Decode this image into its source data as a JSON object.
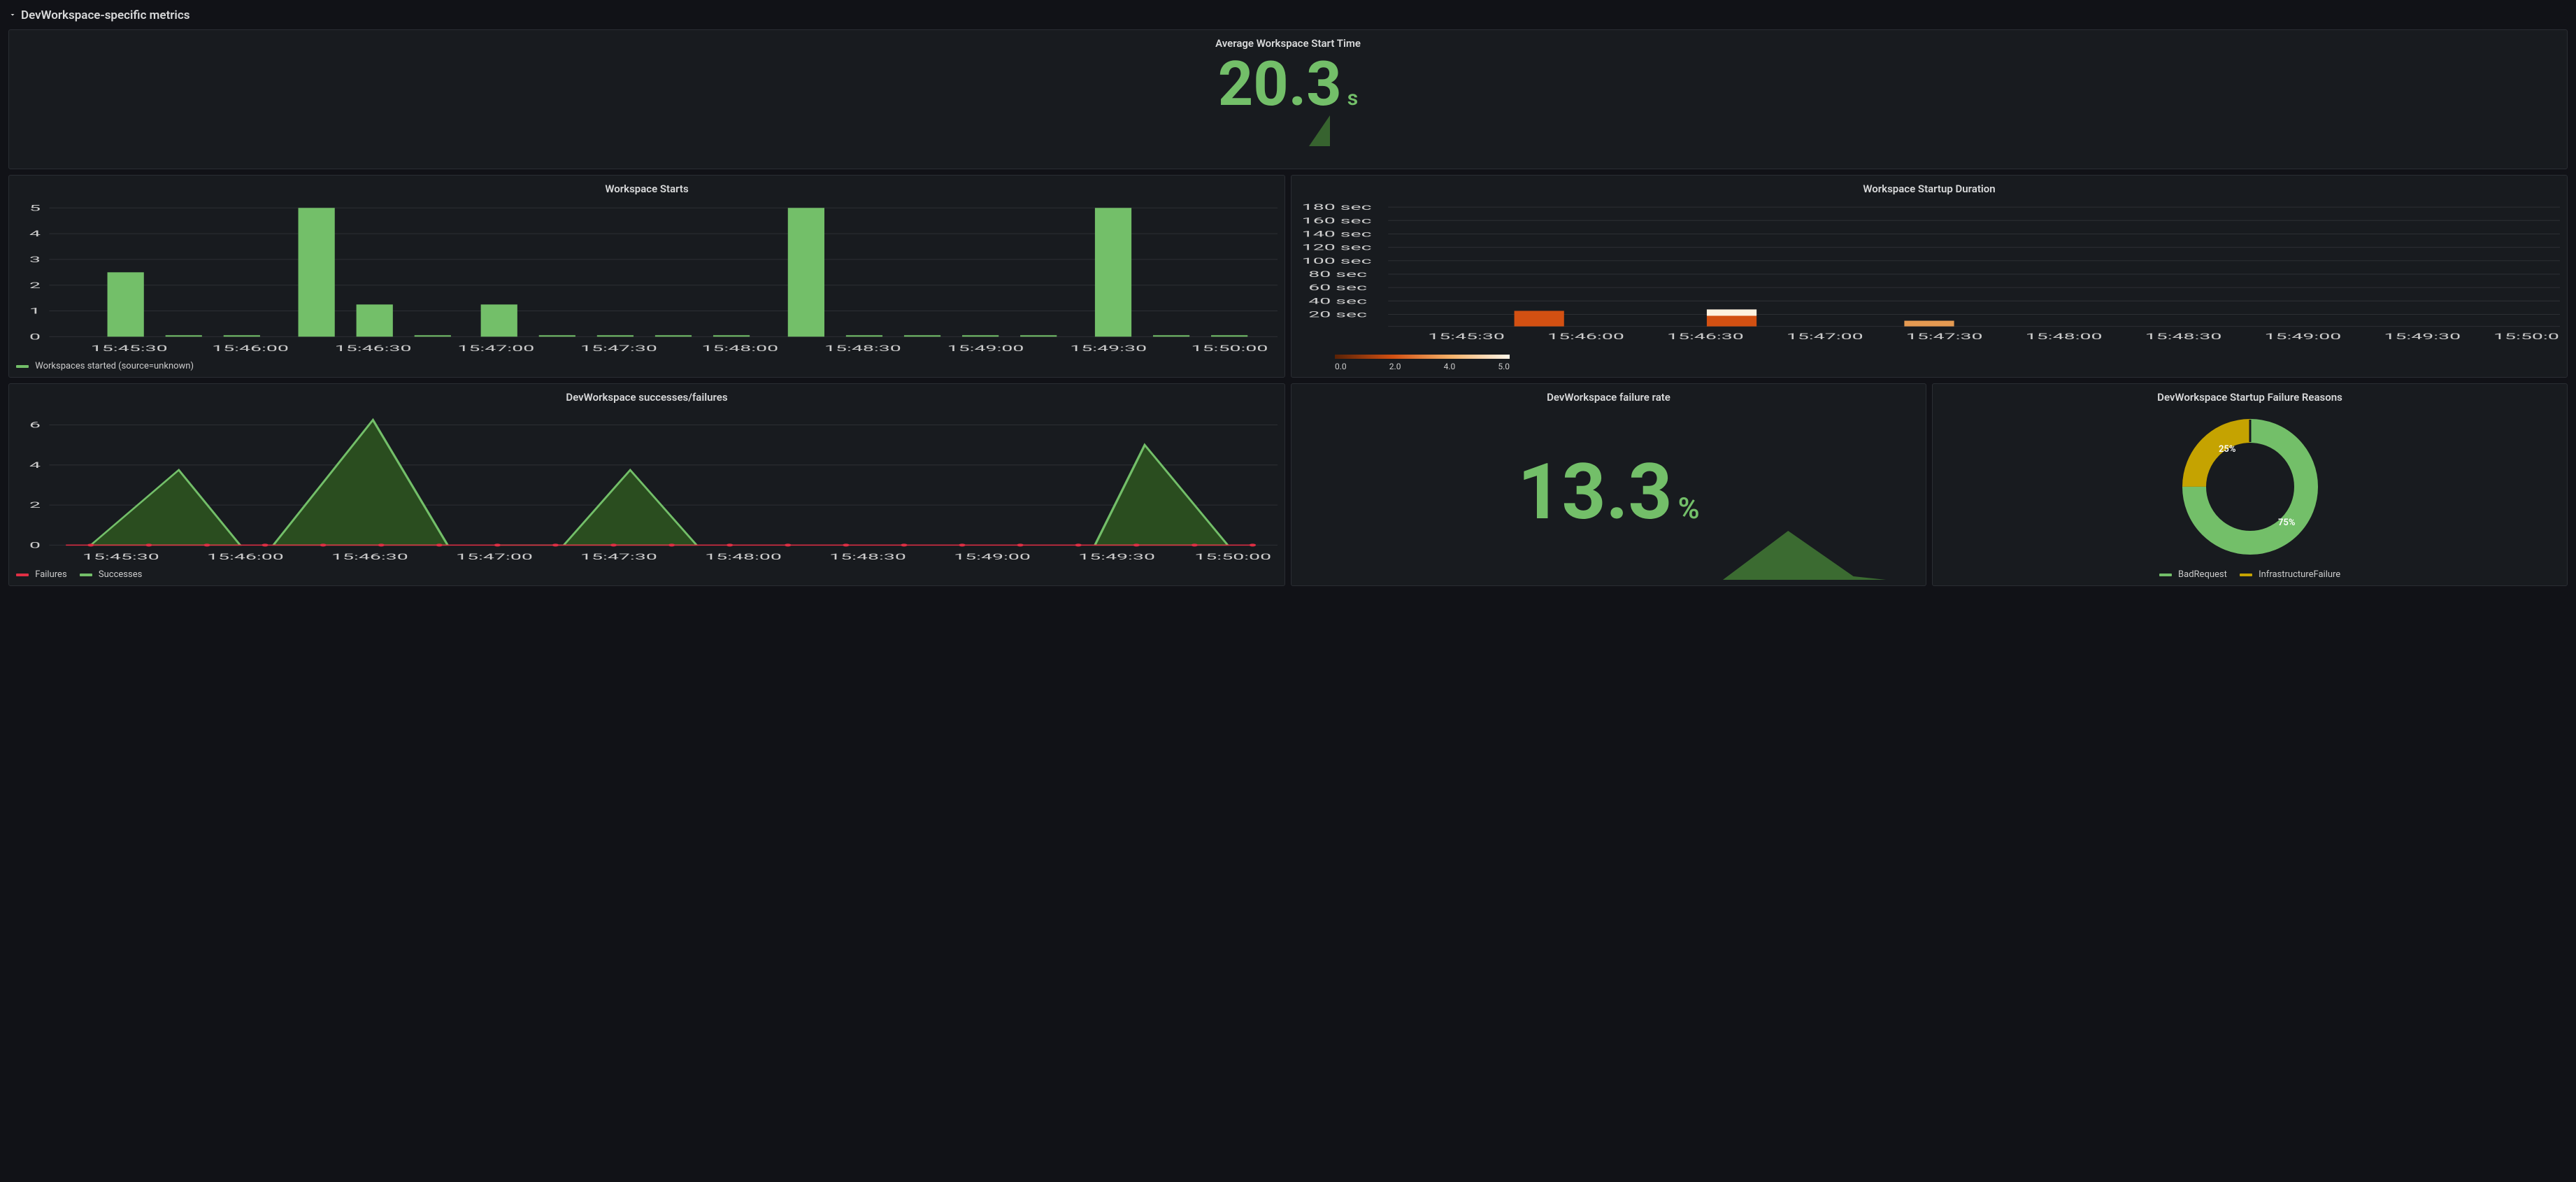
{
  "section_title": "DevWorkspace-specific metrics",
  "colors": {
    "green": "#73bf69",
    "dark_green_fill": "#2a4d1f",
    "red": "#e02f44",
    "yellow": "#c5a301"
  },
  "panels": {
    "avg": {
      "title": "Average Workspace Start Time",
      "value": "20.3",
      "unit": "s"
    },
    "starts": {
      "title": "Workspace Starts",
      "legend": "Workspaces started (source=unknown)"
    },
    "dur": {
      "title": "Workspace Startup Duration"
    },
    "sf": {
      "title": "DevWorkspace successes/failures",
      "legend_failures": "Failures",
      "legend_successes": "Successes"
    },
    "rate": {
      "title": "DevWorkspace failure rate",
      "value": "13.3",
      "unit": "%"
    },
    "reasons": {
      "title": "DevWorkspace Startup Failure Reasons",
      "legend_bad": "BadRequest",
      "legend_infra": "InfrastructureFailure"
    }
  },
  "chart_data": [
    {
      "id": "avg_start_time",
      "type": "stat",
      "title": "Average Workspace Start Time",
      "value": 20.3,
      "unit": "s",
      "sparkline": [
        0.0,
        0.0,
        0.0,
        20.3
      ]
    },
    {
      "id": "workspace_starts",
      "type": "bar",
      "title": "Workspace Starts",
      "xlabel": "",
      "ylabel": "",
      "ylim": [
        0,
        5
      ],
      "yticks": [
        0,
        1,
        2,
        3,
        4,
        5
      ],
      "categories": [
        "15:45:30",
        "15:46:00",
        "15:46:30",
        "15:47:00",
        "15:47:30",
        "15:48:00",
        "15:48:30",
        "15:49:00",
        "15:49:30",
        "15:50:00"
      ],
      "series": [
        {
          "name": "Workspaces started (source=unknown)",
          "color": "#73bf69",
          "values": [
            2.5,
            5,
            1.25,
            1.25,
            0,
            0,
            5,
            0,
            0,
            5,
            0
          ]
        }
      ],
      "bars_x": [
        "15:45:30",
        "15:46:12",
        "15:46:30",
        "15:47:00",
        "-",
        "-",
        "15:48:15",
        "-",
        "-",
        "15:49:30",
        "-"
      ]
    },
    {
      "id": "startup_duration",
      "type": "heatmap",
      "title": "Workspace Startup Duration",
      "xlabel": "",
      "ylabel": "",
      "xticks": [
        "15:45:30",
        "15:46:00",
        "15:46:30",
        "15:47:00",
        "15:47:30",
        "15:48:00",
        "15:48:30",
        "15:49:00",
        "15:49:30",
        "15:50:00"
      ],
      "yticks_sec": [
        20,
        40,
        60,
        80,
        100,
        120,
        140,
        160,
        180
      ],
      "ylim": [
        0,
        180
      ],
      "color_scale": {
        "min": 0.0,
        "max": 5.0,
        "ticks": [
          0.0,
          2.0,
          4.0,
          5.0
        ]
      },
      "cells": [
        {
          "x": "15:46:00",
          "y_low": 0,
          "y_high": 20,
          "value": 2.0,
          "color": "#d25012"
        },
        {
          "x": "15:46:00",
          "y_low": 20,
          "y_high": 30,
          "value": 2.0,
          "color": "#d25012"
        },
        {
          "x": "15:46:30",
          "y_low": 0,
          "y_high": 20,
          "value": 2.0,
          "color": "#d25012"
        },
        {
          "x": "15:46:30",
          "y_low": 20,
          "y_high": 30,
          "value": 4.5,
          "color": "#fef2e0"
        },
        {
          "x": "15:47:20",
          "y_low": 0,
          "y_high": 12,
          "value": 3.0,
          "color": "#e59a52"
        }
      ]
    },
    {
      "id": "successes_failures",
      "type": "area",
      "title": "DevWorkspace successes/failures",
      "xlabel": "",
      "ylabel": "",
      "ylim": [
        0,
        6.5
      ],
      "yticks": [
        0,
        2,
        4,
        6
      ],
      "categories": [
        "15:45:30",
        "15:46:00",
        "15:46:30",
        "15:47:00",
        "15:47:30",
        "15:48:00",
        "15:48:30",
        "15:49:00",
        "15:49:30",
        "15:50:00"
      ],
      "series": [
        {
          "name": "Successes",
          "color": "#73bf69",
          "points": [
            {
              "x": "15:45:15",
              "y": 0
            },
            {
              "x": "15:45:45",
              "y": 3.75
            },
            {
              "x": "15:46:00",
              "y": 0
            },
            {
              "x": "15:46:20",
              "y": 6.25
            },
            {
              "x": "15:46:45",
              "y": 0
            },
            {
              "x": "15:47:00",
              "y": 0
            },
            {
              "x": "15:47:30",
              "y": 3.75
            },
            {
              "x": "15:48:00",
              "y": 0
            },
            {
              "x": "15:49:15",
              "y": 0
            },
            {
              "x": "15:49:30",
              "y": 5
            },
            {
              "x": "15:50:00",
              "y": 0
            }
          ]
        },
        {
          "name": "Failures",
          "color": "#e02f44",
          "points": [
            {
              "x": "15:45:15",
              "y": 0
            },
            {
              "x": "15:50:00",
              "y": 0
            }
          ]
        }
      ]
    },
    {
      "id": "failure_rate",
      "type": "stat",
      "title": "DevWorkspace failure rate",
      "value": 13.3,
      "unit": "%",
      "sparkline": [
        0,
        0,
        0,
        0,
        13.3,
        0
      ]
    },
    {
      "id": "failure_reasons",
      "type": "pie",
      "title": "DevWorkspace Startup Failure Reasons",
      "slices": [
        {
          "name": "BadRequest",
          "value": 75,
          "label": "75%",
          "color": "#73bf69"
        },
        {
          "name": "InfrastructureFailure",
          "value": 25,
          "label": "25%",
          "color": "#c5a301"
        }
      ]
    }
  ]
}
